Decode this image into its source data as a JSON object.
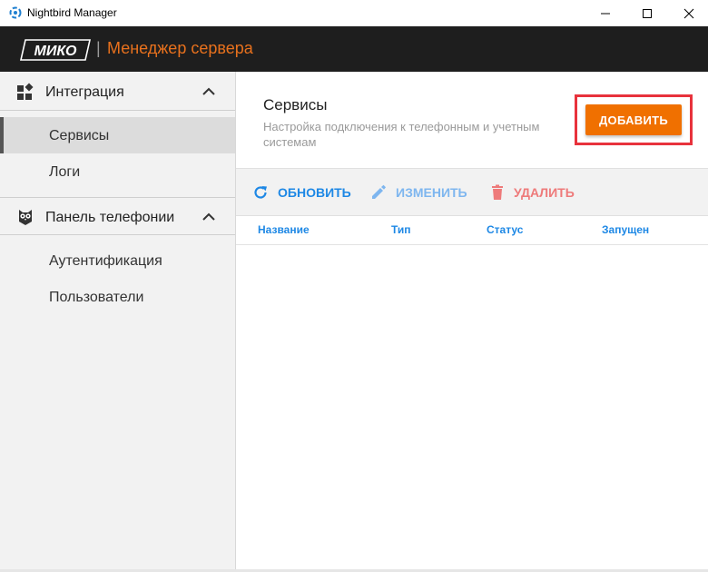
{
  "window": {
    "title": "Nightbird Manager",
    "icon": "nightbird-app-icon",
    "controls": [
      "minimize-icon",
      "maximize-icon",
      "close-icon"
    ]
  },
  "header": {
    "logo_text": "МИКО",
    "separator": "|",
    "title": "Менеджер сервера",
    "accent_color": "#e8711d",
    "background": "#1e1e1e"
  },
  "sidebar": {
    "groups": [
      {
        "label": "Интеграция",
        "icon": "widgets-icon",
        "expanded": true,
        "items": [
          {
            "label": "Сервисы",
            "active": true
          },
          {
            "label": "Логи",
            "active": false
          }
        ]
      },
      {
        "label": "Панель телефонии",
        "icon": "owl-icon",
        "expanded": true,
        "items": [
          {
            "label": "Аутентификация",
            "active": false
          },
          {
            "label": "Пользователи",
            "active": false
          }
        ]
      }
    ]
  },
  "main": {
    "title": "Сервисы",
    "subtitle": "Настройка подключения к телефонным и учетным системам",
    "add_button": "ДОБАВИТЬ",
    "add_button_color": "#f07000",
    "highlight_color": "#e8323c",
    "toolbar": {
      "refresh": "ОБНОВИТЬ",
      "edit": "ИЗМЕНИТЬ",
      "delete": "УДАЛИТЬ"
    },
    "table": {
      "columns": [
        "Название",
        "Тип",
        "Статус",
        "Запущен"
      ],
      "rows": []
    }
  }
}
